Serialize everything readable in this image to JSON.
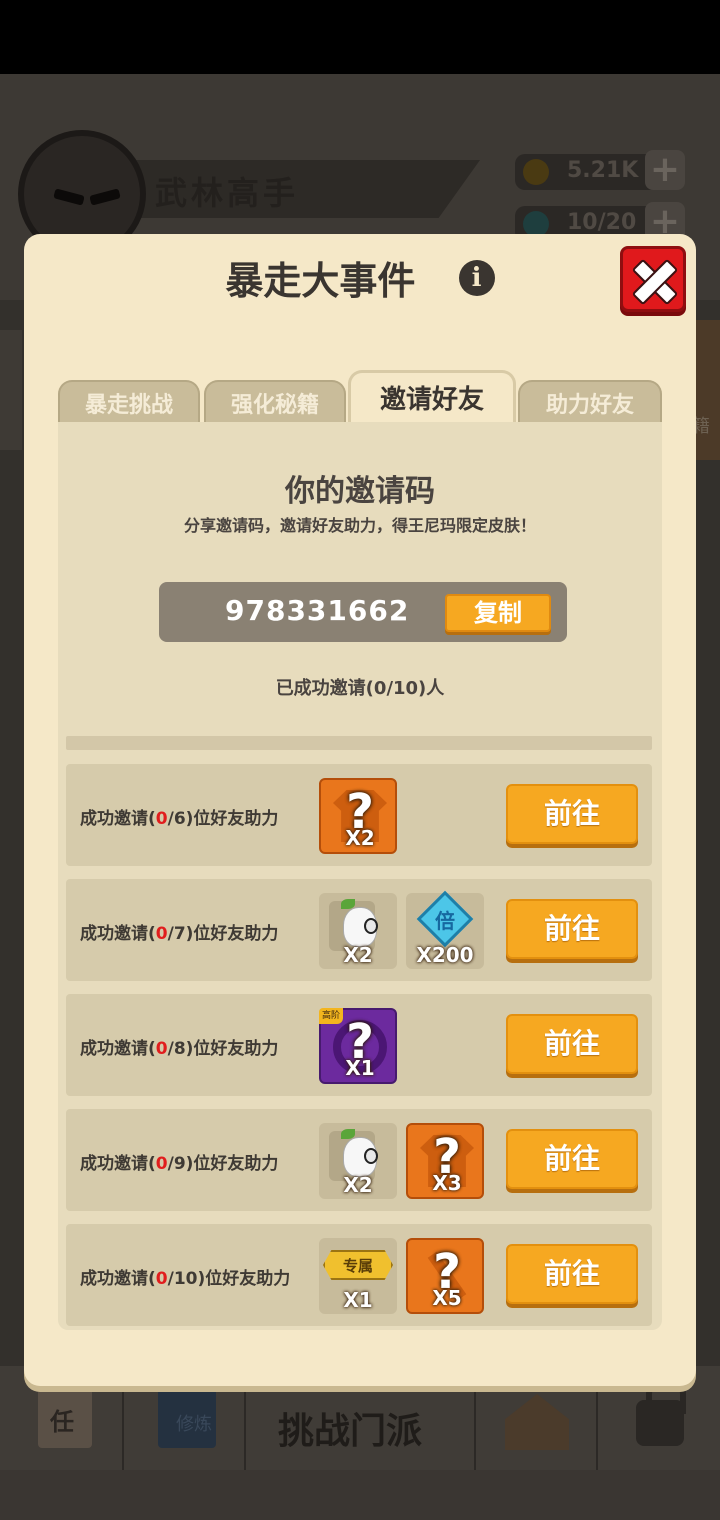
{
  "background": {
    "player_name": "武林高手",
    "resources": [
      {
        "name": "coin",
        "value": "5.21K"
      },
      {
        "name": "energy",
        "value": "10/20"
      }
    ],
    "side_label": "籍",
    "bottom_center_label": "挑战门派",
    "scroll_label": "任",
    "book_label": "修炼"
  },
  "dialog": {
    "title": "暴走大事件",
    "info_icon": "i",
    "tabs": [
      {
        "label": "暴走挑战",
        "active": false
      },
      {
        "label": "强化秘籍",
        "active": false
      },
      {
        "label": "邀请好友",
        "active": true
      },
      {
        "label": "助力好友",
        "active": false
      }
    ],
    "invite": {
      "title": "你的邀请码",
      "subtitle": "分享邀请码，邀请好友助力，得王尼玛限定皮肤！",
      "code": "978331662",
      "copy_label": "复制",
      "invited_text": "已成功邀请(0/10)人"
    },
    "rewards": [
      {
        "prefix": "成功邀请(",
        "current": "0",
        "suffix": "/6)位好友助力",
        "button": "前往",
        "items": [
          {
            "type": "mystery-shirt",
            "qty": "X2"
          }
        ]
      },
      {
        "prefix": "成功邀请(",
        "current": "0",
        "suffix": "/7)位好友助力",
        "button": "前往",
        "items": [
          {
            "type": "avatar-piece",
            "qty": "X2"
          },
          {
            "type": "multiplier-diamond",
            "label": "倍",
            "qty": "X200"
          }
        ]
      },
      {
        "prefix": "成功邀请(",
        "current": "0",
        "suffix": "/8)位好友助力",
        "button": "前往",
        "items": [
          {
            "type": "advanced-mystery",
            "tag": "高阶",
            "qty": "X1"
          }
        ]
      },
      {
        "prefix": "成功邀请(",
        "current": "0",
        "suffix": "/9)位好友助力",
        "button": "前往",
        "items": [
          {
            "type": "avatar-piece",
            "qty": "X2"
          },
          {
            "type": "mystery-shirt",
            "qty": "X3"
          }
        ]
      },
      {
        "prefix": "成功邀请(",
        "current": "0",
        "suffix": "/10)位好友助力",
        "button": "前往",
        "items": [
          {
            "type": "exclusive-badge",
            "label": "专属",
            "qty": "X1"
          },
          {
            "type": "mystery-weapon",
            "qty": "X5"
          }
        ]
      }
    ]
  },
  "colors": {
    "dialog_bg": "#f5e8c8",
    "button_orange": "#f6a821",
    "close_red": "#e0191c",
    "highlight_red": "#e11d1d"
  }
}
